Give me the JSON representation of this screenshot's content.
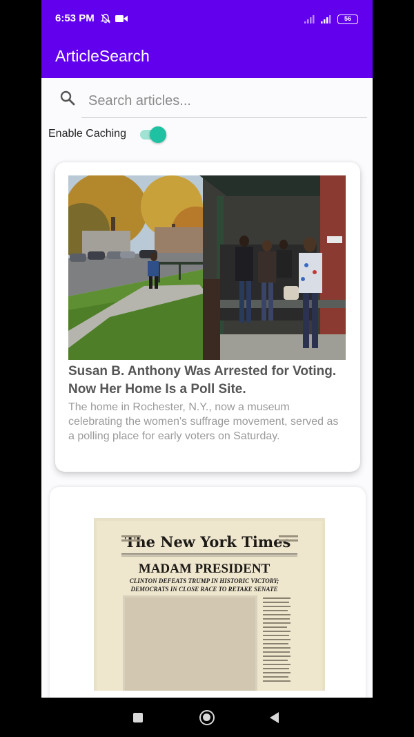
{
  "status": {
    "time": "6:53 PM",
    "battery": "56"
  },
  "app": {
    "title": "ArticleSearch"
  },
  "search": {
    "placeholder": "Search articles..."
  },
  "caching": {
    "label": "Enable Caching",
    "enabled": true
  },
  "articles": [
    {
      "title": "Susan B. Anthony Was Arrested for Voting. Now Her Home Is a Poll Site.",
      "abstract": "The home in Rochester, N.Y., now a museum celebrating the women's suffrage movement, served as a polling place for early voters on Saturday."
    },
    {
      "masthead": "The New York Times",
      "headline": "MADAM PRESIDENT",
      "subhead_1": "CLINTON DEFEATS TRUMP IN HISTORIC VICTORY;",
      "subhead_2": "DEMOCRATS IN CLOSE RACE TO RETAKE SENATE"
    }
  ],
  "colors": {
    "primary": "#6200EE",
    "switch_accent": "#1ec2a2"
  }
}
